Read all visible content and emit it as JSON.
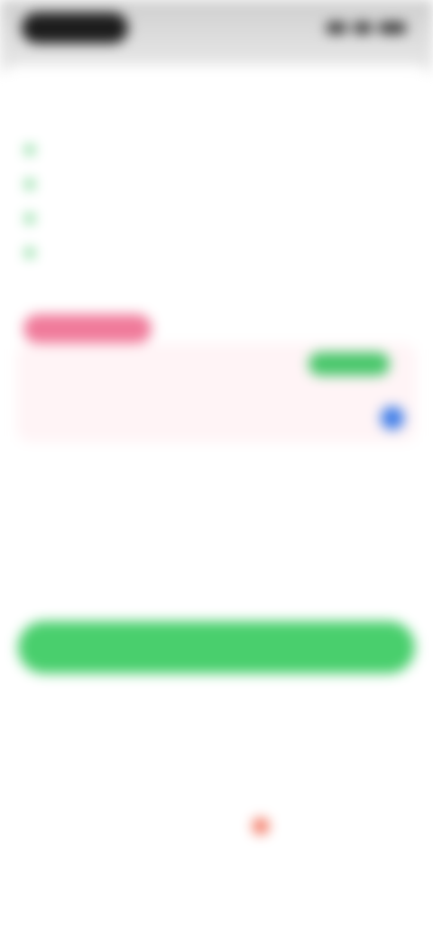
{
  "status_bar": {
    "time": "",
    "icons": [
      "signal-icon",
      "wifi-icon",
      "battery-icon"
    ]
  },
  "header": {
    "title": ""
  },
  "features": [
    {
      "label": ""
    },
    {
      "label": ""
    },
    {
      "label": ""
    },
    {
      "label": ""
    }
  ],
  "offer": {
    "badge_label": "",
    "plan_label": "",
    "plan_price": "",
    "save_label": "",
    "selected": true
  },
  "alt_plan": {
    "plan_label": "",
    "plan_price": ""
  },
  "note": "",
  "cta_label": "",
  "footer": {
    "text": "",
    "sub": ""
  },
  "colors": {
    "accent_green": "#49cf6d",
    "badge_pink": "#f07a9a",
    "radio_blue": "#3f7de8",
    "heart_red": "#f2705a"
  }
}
